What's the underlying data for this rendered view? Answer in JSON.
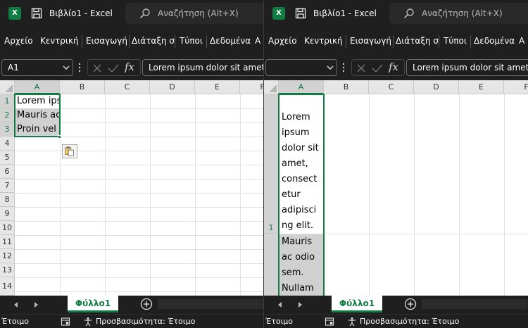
{
  "title": "Βιβλίο1 - Excel",
  "app_badge": "X",
  "search_placeholder": "Αναζήτηση (Alt+X)",
  "menu": [
    "Αρχείο",
    "Κεντρική",
    "Εισαγωγή",
    "Διάταξη σ",
    "Τύποι",
    "Δεδομένα",
    "Α"
  ],
  "formula_icon": "fx",
  "left": {
    "name_box": "A1",
    "formula": "Lorem ipsum dolor sit amet, consectetur adipiscing elit.",
    "columns": [
      "A",
      "B",
      "C",
      "D",
      "E",
      "F"
    ],
    "rows": [
      "1",
      "2",
      "3",
      "4",
      "5",
      "6",
      "7",
      "8",
      "9",
      "10",
      "11",
      "12",
      "13",
      "14"
    ],
    "cells": [
      "Lorem ipsum dolor sit amet, consectetur adipiscing elit.",
      "Mauris ac odio sem.",
      "Proin vel"
    ]
  },
  "right": {
    "name_box": "",
    "formula": "Lorem ipsum dolor sit amet, consectetur adipiscing elit.",
    "columns": [
      "A",
      "B",
      "C",
      "D",
      "E",
      "F"
    ],
    "rows": [
      "1"
    ],
    "cell_a1_lines": [
      "Lorem",
      "ipsum",
      "dolor sit",
      "amet,",
      "consect",
      "etur",
      "adipisci",
      "ng elit."
    ],
    "cell_a2_lines": [
      "Mauris",
      "ac odio",
      "sem.",
      "Nullam"
    ]
  },
  "sheet_tab": "Φύλλο1",
  "status": {
    "ready": "Έτοιμο",
    "accessibility": "Προσβασιμότητα: Έτοιμο"
  },
  "colors": {
    "excel_green": "#107c41",
    "chrome_bg": "#1f1f1f",
    "selected_fill": "#d0d0d0"
  }
}
